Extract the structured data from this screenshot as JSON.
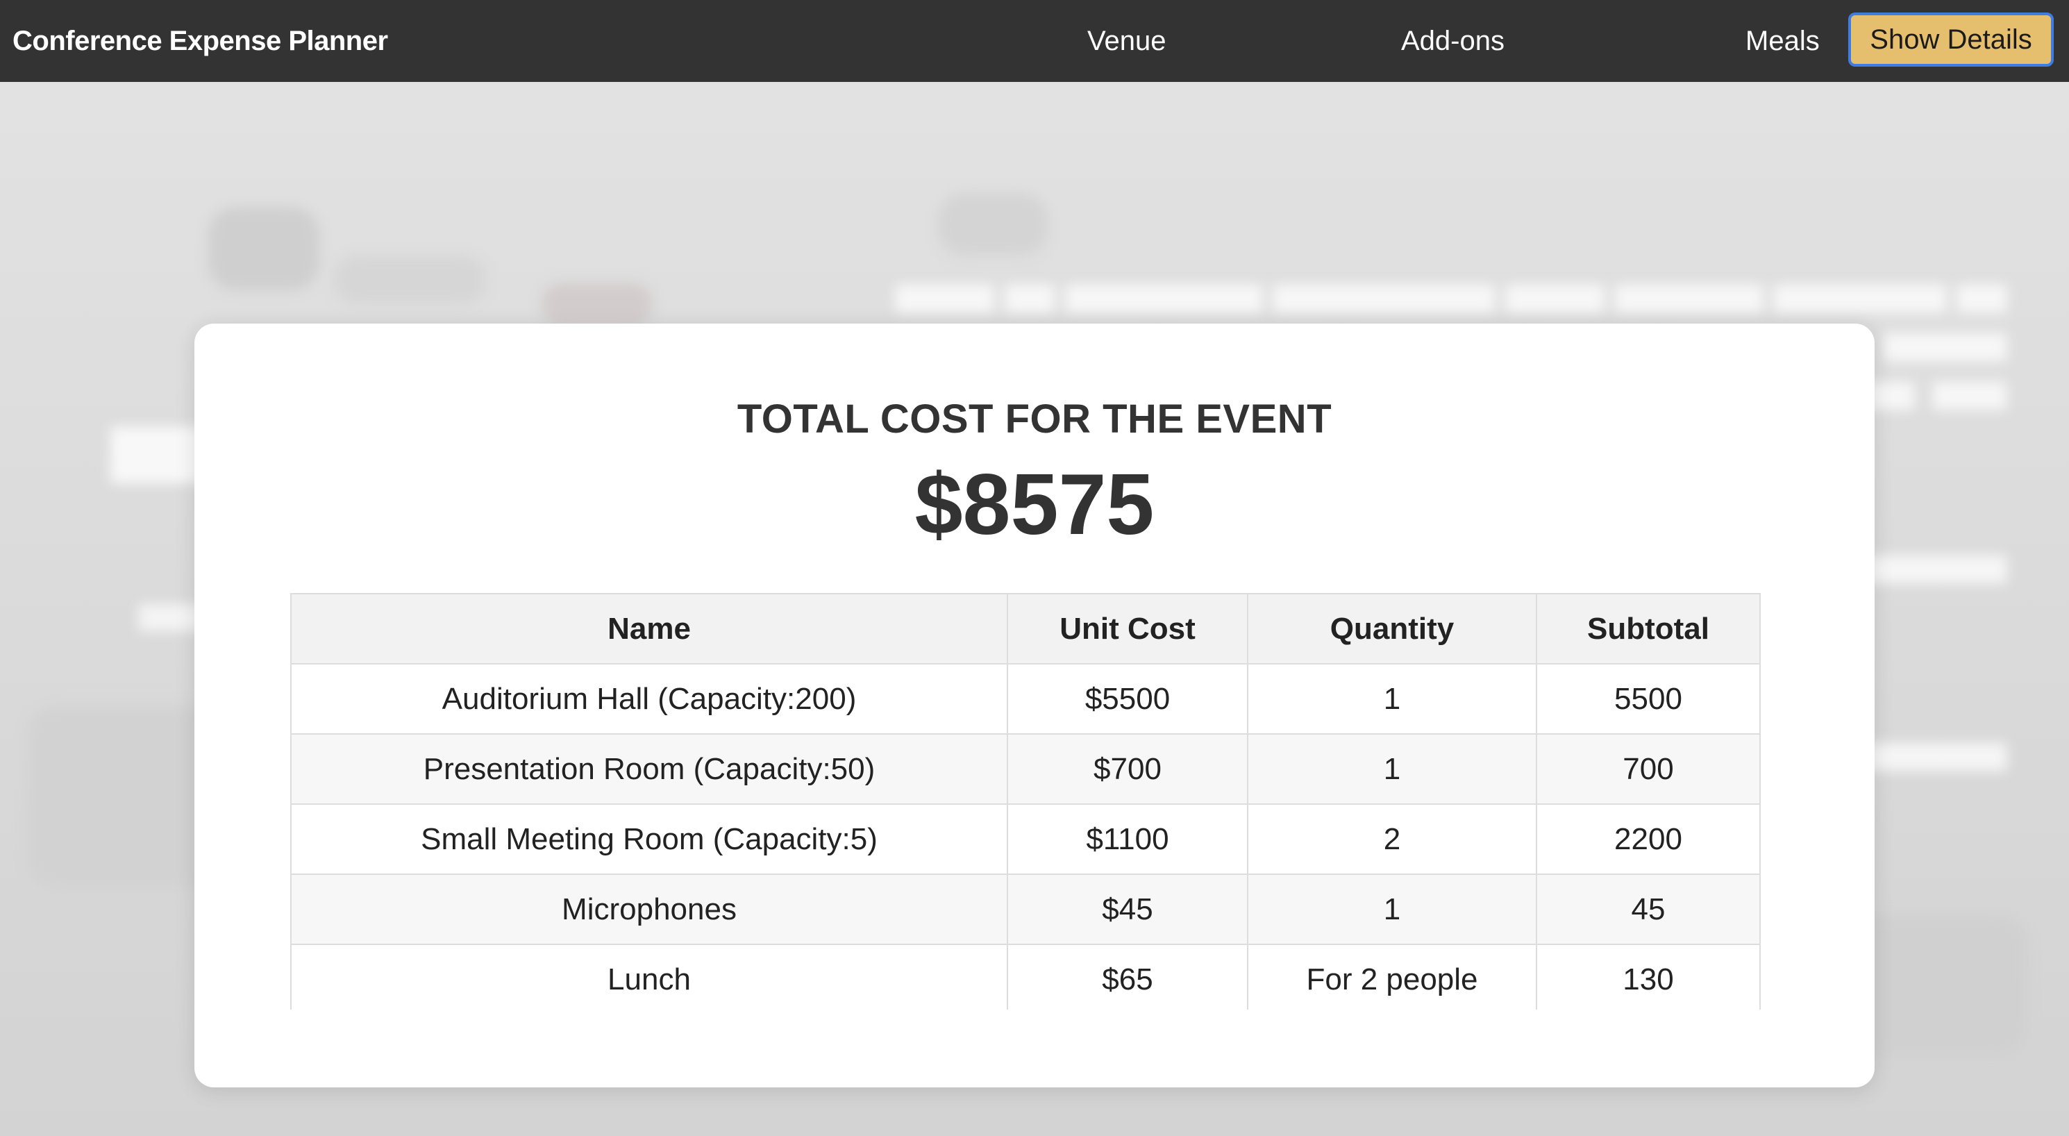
{
  "app": {
    "title": "Conference Expense Planner"
  },
  "nav": {
    "links": [
      {
        "label": "Venue"
      },
      {
        "label": "Add-ons"
      },
      {
        "label": "Meals"
      }
    ],
    "details_button": "Show Details",
    "details_button_color": "#e6bf6e"
  },
  "summary": {
    "heading": "TOTAL COST FOR THE EVENT",
    "total": "$8575"
  },
  "table": {
    "columns": [
      "Name",
      "Unit Cost",
      "Quantity",
      "Subtotal"
    ],
    "rows": [
      {
        "name": "Auditorium Hall (Capacity:200)",
        "unit_cost": "$5500",
        "quantity": "1",
        "subtotal": "5500"
      },
      {
        "name": "Presentation Room (Capacity:50)",
        "unit_cost": "$700",
        "quantity": "1",
        "subtotal": "700"
      },
      {
        "name": "Small Meeting Room (Capacity:5)",
        "unit_cost": "$1100",
        "quantity": "2",
        "subtotal": "2200"
      },
      {
        "name": "Microphones",
        "unit_cost": "$45",
        "quantity": "1",
        "subtotal": "45"
      },
      {
        "name": "Lunch",
        "unit_cost": "$65",
        "quantity": "For 2 people",
        "subtotal": "130"
      }
    ]
  }
}
